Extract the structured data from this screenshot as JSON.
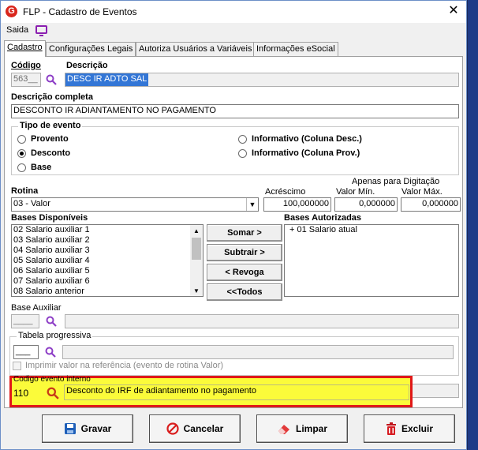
{
  "window": {
    "title": "FLP - Cadastro de Eventos",
    "close_glyph": "✕",
    "app_icon": "G"
  },
  "menu": {
    "saida": "Saida"
  },
  "tabs": [
    "Cadastro",
    "Configurações Legais",
    "Autoriza Usuários a Variáveis",
    "Informações eSocial"
  ],
  "form": {
    "codigo_label": "Código",
    "codigo_value": "563__",
    "descricao_label": "Descrição",
    "descricao_value": "DESC IR ADTO SAL",
    "desc_completa_label": "Descrição completa",
    "desc_completa_value": "DESCONTO IR ADIANTAMENTO NO PAGAMENTO",
    "tipo_evento_label": "Tipo de evento",
    "tipo_options": [
      "Provento",
      "Desconto",
      "Base",
      "Informativo (Coluna Desc.)",
      "Informativo (Coluna Prov.)"
    ],
    "tipo_selected": "Desconto",
    "rotina_label": "Rotina",
    "rotina_value": "03 - Valor",
    "acrescimo_label": "Acréscimo",
    "acrescimo_value": "100,000000",
    "apenas_label": "Apenas para Digitação",
    "valor_min_label": "Valor Mín.",
    "valor_min_value": "0,000000",
    "valor_max_label": "Valor Máx.",
    "valor_max_value": "0,000000",
    "bases_disp_label": "Bases Disponíveis",
    "bases_disp": [
      "02 Salario auxiliar 1",
      "03 Salario auxiliar 2",
      "04 Salario auxiliar 3",
      "05 Salario auxiliar 4",
      "06 Salario auxiliar 5",
      "07 Salario auxiliar 6",
      "08 Salario anterior"
    ],
    "bases_aut_label": "Bases Autorizadas",
    "bases_aut": [
      "+ 01 Salario atual"
    ],
    "btn_somar": "Somar >",
    "btn_subtrair": "Subtrair >",
    "btn_revoga": "< Revoga",
    "btn_todos": "<<Todos",
    "base_aux_label": "Base Auxiliar",
    "base_aux_value": "____",
    "tabela_label": "Tabela progressiva",
    "tabela_value": "___",
    "imprimir_label": "Imprimir valor na referência (evento de rotina Valor)",
    "cod_interno_label": "Codigo evento interno",
    "cod_interno_value": "110",
    "cod_interno_desc": "Desconto do IRF de adiantamento no pagamento"
  },
  "buttons": {
    "gravar": "Gravar",
    "cancelar": "Cancelar",
    "limpar": "Limpar",
    "excluir": "Excluir"
  },
  "colors": {
    "highlight": "#fbfb3a",
    "highlight_border": "#e01818",
    "selection": "#3376d6"
  }
}
